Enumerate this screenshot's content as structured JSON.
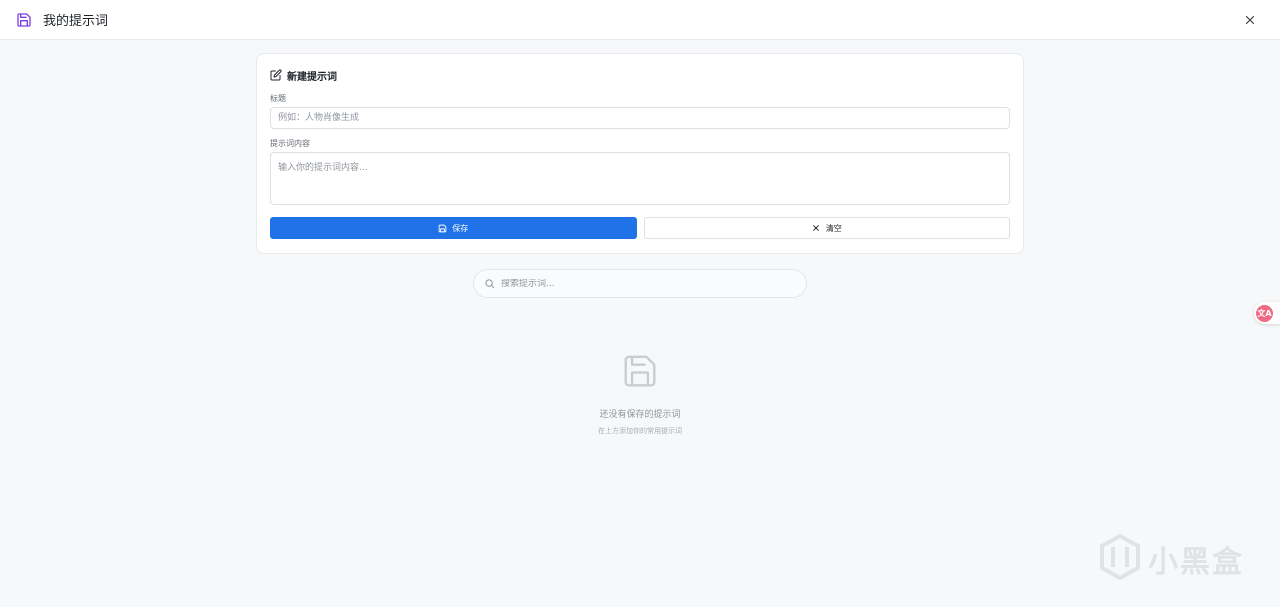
{
  "window": {
    "title": "我的提示词",
    "app_icon": "save-icon",
    "close_icon": "close-icon",
    "accent_color": "#7b3fe4"
  },
  "form": {
    "header": "新建提示词",
    "header_icon": "edit-icon",
    "title_label": "标题",
    "title_placeholder": "例如：人物肖像生成",
    "title_value": "",
    "content_label": "提示词内容",
    "content_placeholder": "输入你的提示词内容...",
    "content_value": "",
    "save_label": "保存",
    "save_icon": "save-icon",
    "clear_label": "清空",
    "clear_icon": "close-icon",
    "primary_color": "#1f72e8"
  },
  "search": {
    "placeholder": "搜索提示词...",
    "value": "",
    "icon": "search-icon"
  },
  "empty_state": {
    "icon": "save-icon",
    "title": "还没有保存的提示词",
    "subtitle": "在上方添加你的常用提示词"
  },
  "floating": {
    "translate_icon": "translate-icon",
    "translate_glyph": "文A",
    "translate_color": "#ef6b84"
  },
  "watermark": {
    "text": "小黑盒"
  }
}
